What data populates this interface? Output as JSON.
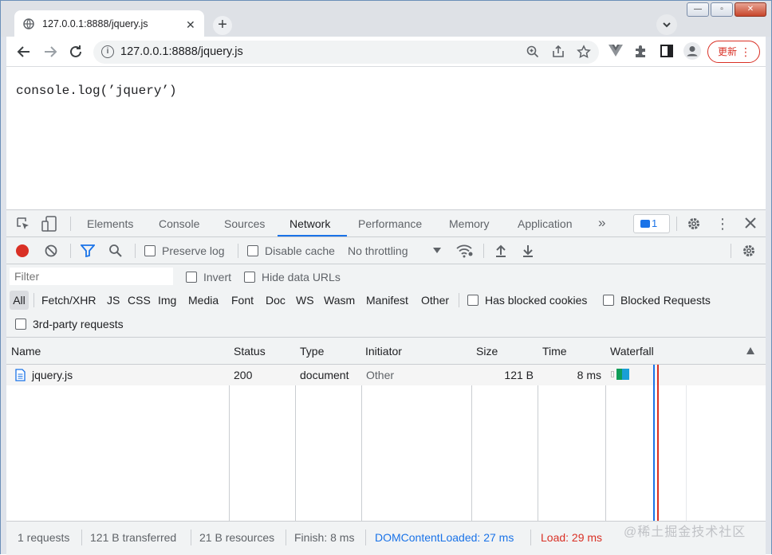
{
  "browser": {
    "tab_title": "127.0.0.1:8888/jquery.js",
    "tab_close": "✕",
    "new_tab": "+",
    "url": "127.0.0.1:8888/jquery.js",
    "update_label": "更新"
  },
  "page": {
    "code": "console.log(’jquery’)"
  },
  "devtools": {
    "tabs": [
      "Elements",
      "Console",
      "Sources",
      "Network",
      "Performance",
      "Memory",
      "Application"
    ],
    "active_tab": "Network",
    "more_tabs": "»",
    "message_count": "1",
    "toolbar": {
      "preserve_log": "Preserve log",
      "disable_cache": "Disable cache",
      "throttling": "No throttling"
    },
    "filter": {
      "placeholder": "Filter",
      "invert": "Invert",
      "hide_data_urls": "Hide data URLs",
      "types": [
        "All",
        "Fetch/XHR",
        "JS",
        "CSS",
        "Img",
        "Media",
        "Font",
        "Doc",
        "WS",
        "Wasm",
        "Manifest",
        "Other"
      ],
      "has_blocked_cookies": "Has blocked cookies",
      "blocked_requests": "Blocked Requests",
      "third_party": "3rd-party requests"
    },
    "table": {
      "headers": [
        "Name",
        "Status",
        "Type",
        "Initiator",
        "Size",
        "Time",
        "Waterfall"
      ],
      "rows": [
        {
          "name": "jquery.js",
          "status": "200",
          "type": "document",
          "initiator": "Other",
          "size": "121 B",
          "time": "8 ms"
        }
      ]
    },
    "status": {
      "requests": "1 requests",
      "transferred": "121 B transferred",
      "resources": "21 B resources",
      "finish": "Finish: 8 ms",
      "dom_content_loaded": "DOMContentLoaded: 27 ms",
      "load": "Load: 29 ms"
    },
    "colors": {
      "accent": "#1a73e8",
      "record": "#d93025",
      "dcl": "#1a73e8",
      "load": "#d93025"
    }
  },
  "watermark": "@稀土掘金技术社区"
}
